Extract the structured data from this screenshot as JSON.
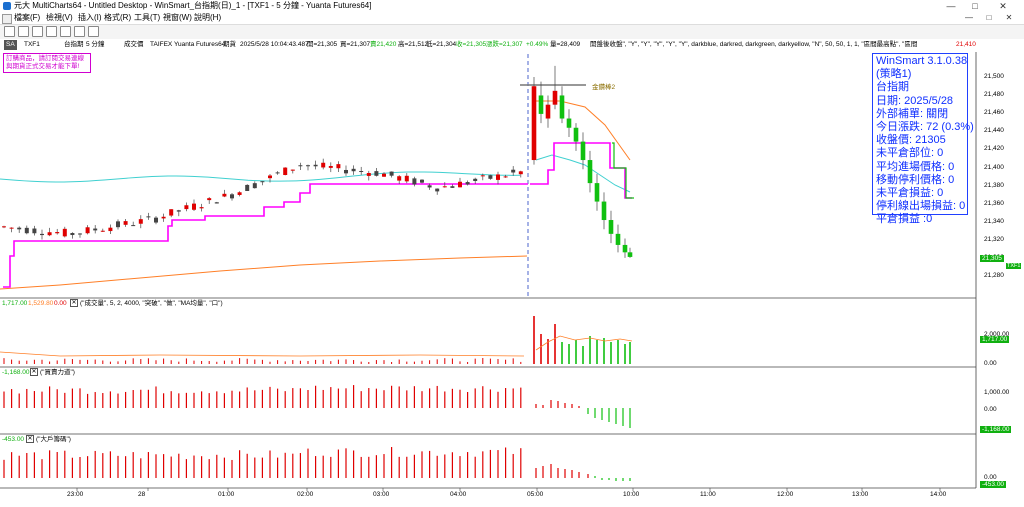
{
  "window": {
    "title": "元大 MultiCharts64 - Untitled Desktop - WinSmart_台指期(日)_1 - [TXF1 - 5 分鐘 - Yuanta Futures64]",
    "controls": [
      "—",
      "□",
      "✕"
    ],
    "inner_controls": [
      "—",
      "□",
      "✕"
    ]
  },
  "menu": [
    "檔案(F)",
    "檢視(V)",
    "插入(I)",
    "格式(R)",
    "工具(T)",
    "視窗(W)",
    "說明(H)"
  ],
  "infobar": {
    "symbol_tag": "SA",
    "symbol": "TXF1",
    "name": "台指期",
    "interval": "5 分鐘",
    "chart_type": "成交價",
    "exchange": "TAIFEX",
    "datafeed": "Yuanta Futures64",
    "session": "期貨",
    "datetime": "2025/5/28  10:04:43.487",
    "open": "開=21,305",
    "bid": "買=21,307",
    "ask_val": "賣21,420",
    "high": "高=21,512",
    "low": "低=21,304",
    "ask2": "收=21,305",
    "chg": "漲跌=21,307",
    "chg_pct": "+0.49%",
    "volume": "量=28,409",
    "study": "開盤後收盤\", \"Y\", \"Y\", \"Y\", \"Y\", \"Y\", darkblue, darkred, darkgreen, darkyellow, \"N\", 50, 50, 1, 1, \"區間最高點\", \"區間",
    "right_price": "21,410"
  },
  "notice": [
    "訂購商品，請訂閱交易連線",
    "與期貨正式交易才能下單!"
  ],
  "winsmart_panel": {
    "lines": [
      "WinSmart 3.1.0.38",
      "(策略1)",
      "台指期",
      "日期: 2025/5/28",
      "外部補單: 關閉",
      "今日漲跌: 72 (0.3%)",
      "收盤價: 21305",
      "未平倉部位: 0",
      "平均進場價格: 0",
      "移動停利價格: 0",
      "未平倉損益: 0",
      "停利線出場損益: 0",
      "平倉損益 :0"
    ]
  },
  "annotation": "金鑽棒2",
  "pane1": {
    "price_labels": [
      "21,500",
      "21,480",
      "21,460",
      "21,440",
      "21,420",
      "21,400",
      "21,380",
      "21,360",
      "21,340",
      "21,320",
      "21,300",
      "21,280"
    ],
    "last_price": "21,305",
    "last_tag": "TXF1"
  },
  "pane2": {
    "header_values": [
      "1,717.00",
      "1,529.80",
      "0.00"
    ],
    "header_text": "(\"成交量\", 5, 2, 4000, \"突破\", \"做\", \"MA均量\", \"口\")",
    "scale": [
      "2,000.00",
      "0.00"
    ],
    "last": "1,717.00"
  },
  "pane3": {
    "header_value": "-1,168.00",
    "header_text": "(\"買賣力道\")",
    "scale": [
      "1,000.00",
      "0.00"
    ],
    "last": "-1,168.00"
  },
  "pane4": {
    "header_value": "-453.00",
    "header_text": "(\"大戶籌碼\")",
    "scale": [
      "0.00"
    ],
    "last": "-453.00"
  },
  "time_axis": [
    "23:00",
    "28",
    "01:00",
    "02:00",
    "03:00",
    "04:00",
    "05:00",
    "10:00",
    "11:00",
    "12:00",
    "13:00",
    "14:00"
  ],
  "colors": {
    "up": "#e00000",
    "down": "#10c010",
    "magenta_line": "#ff00ff",
    "cyan_line": "#40d0d0",
    "orange_line": "#ff7f27",
    "panel_text": "#1030ff"
  }
}
